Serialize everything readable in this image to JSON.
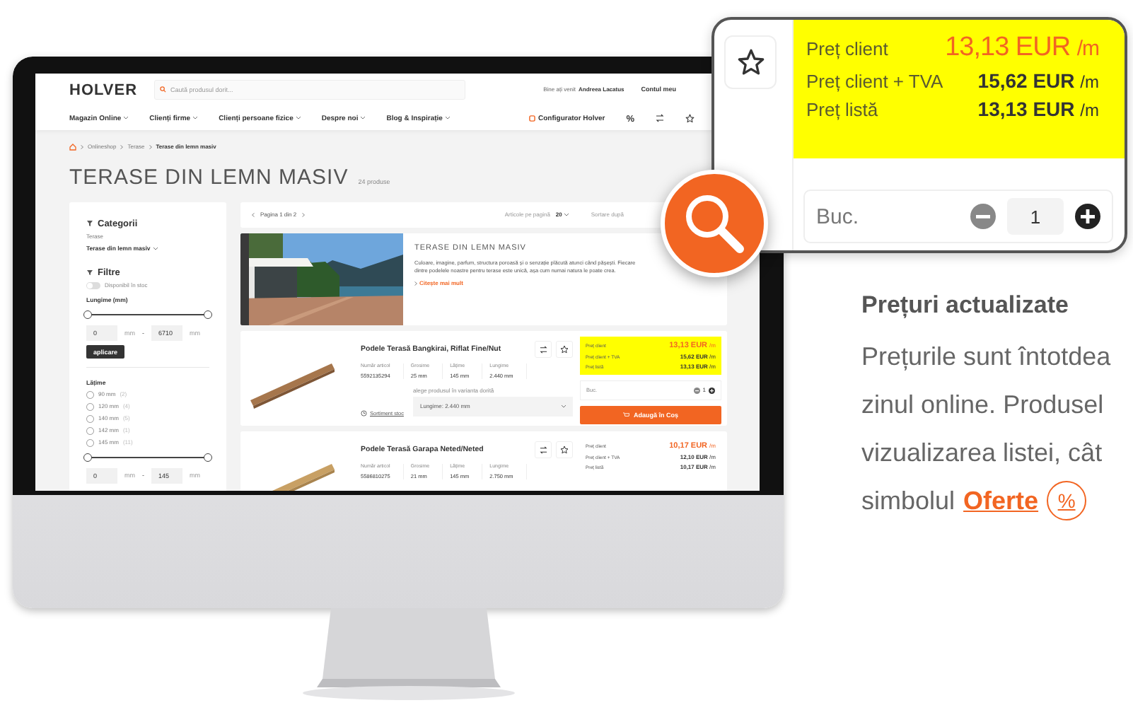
{
  "site": {
    "logo": "HOLVER",
    "search": {
      "placeholder": "Caută produsul dorit..."
    },
    "greeting": "Bine ați venit",
    "user": "Andreea Lacatus",
    "account": "Contul meu",
    "nav": [
      "Magazin Online",
      "Clienți firme",
      "Clienți persoane fizice",
      "Despre noi",
      "Blog & Inspirație"
    ],
    "configurator": "Configurator Holver",
    "offers_icon": "%",
    "breadcrumb": [
      "Onlineshop",
      "Terase",
      "Terase din lemn masiv"
    ],
    "title": "TERASE DIN LEMN MASIV",
    "count": "24 produse",
    "sidebar": {
      "heading": "Categorii",
      "category_label": "Terase",
      "category": "Terase din lemn masiv",
      "filters_heading": "Filtre",
      "stock_toggle": {
        "label": "Disponibil în stoc",
        "on": false
      },
      "filters": [
        {
          "label": "Lungime (mm)",
          "range": {
            "min": "0",
            "min_unit": "mm",
            "max": "6710",
            "max_unit": "mm",
            "separator": "-",
            "level": 1
          },
          "button": "aplicare"
        },
        {
          "label": "Lățime",
          "options": [
            {
              "label": "90 mm",
              "count": "(2)",
              "checked": false
            },
            {
              "label": "120 mm",
              "count": "(4)",
              "checked": false
            },
            {
              "label": "140 mm",
              "count": "(5)",
              "checked": false
            },
            {
              "label": "142 mm",
              "count": "(1)",
              "checked": false
            },
            {
              "label": "145 mm",
              "count": "(11)",
              "checked": false
            }
          ],
          "range": {
            "min": "0",
            "min_unit": "mm",
            "max": "145",
            "max_unit": "mm",
            "separator": "-",
            "level": 1
          }
        }
      ]
    },
    "toolbar": {
      "pagination": "Pagina 1 din 2",
      "per_page_label": "Articole pe pagină",
      "per_page": "20",
      "sort_label": "Sortare după"
    },
    "banner": {
      "title": "TERASE DIN LEMN MASIV",
      "text": "Culoare, imagine, parfum, structura poroasă și o senzație plăcută atunci când pășești. Fiecare dintre podelele noastre pentru terase este unică, așa cum numai natura le poate crea.",
      "more": "Citește mai mult"
    },
    "products": [
      {
        "name": "Podele Terasă Bangkirai, Riflat Fine/Nut",
        "specs": [
          {
            "label": "Număr articol",
            "value": "5592135294"
          },
          {
            "label": "Grosime",
            "value": "25 mm"
          },
          {
            "label": "Lățime",
            "value": "145 mm"
          },
          {
            "label": "Lungime",
            "value": "2.440 mm"
          }
        ],
        "stock": "Sortiment stoc",
        "variant_label": "alege produsul în varianta dorită",
        "variant": "Lungime: 2.440 mm",
        "prices": [
          {
            "label": "Preț client",
            "value": "13,13 EUR",
            "unit": "/m",
            "emphasis": true
          },
          {
            "label": "Preț client + TVA",
            "value": "15,62 EUR",
            "unit": "/m",
            "emphasis": false
          },
          {
            "label": "Preț listă",
            "value": "13,13 EUR",
            "unit": "/m",
            "emphasis": false
          }
        ],
        "highlighted": true,
        "qty_label": "Buc.",
        "qty": "1",
        "cart": "Adaugă în Coș"
      },
      {
        "name": "Podele Terasă Garapa Neted/Neted",
        "specs": [
          {
            "label": "Număr articol",
            "value": "5586810275"
          },
          {
            "label": "Grosime",
            "value": "21 mm"
          },
          {
            "label": "Lățime",
            "value": "145 mm"
          },
          {
            "label": "Lungime",
            "value": "2.750 mm"
          }
        ],
        "prices": [
          {
            "label": "Preț client",
            "value": "10,17 EUR",
            "unit": "/m",
            "emphasis": true
          },
          {
            "label": "Preț client + TVA",
            "value": "12,10 EUR",
            "unit": "/m",
            "emphasis": false
          },
          {
            "label": "Preț listă",
            "value": "10,17 EUR",
            "unit": "/m",
            "emphasis": false
          }
        ],
        "highlighted": false
      }
    ]
  },
  "callout": {
    "prices": [
      {
        "label": "Preț client",
        "value": "13,13 EUR",
        "unit": "/m",
        "emphasis": true
      },
      {
        "label": "Preț client + TVA",
        "value": "15,62 EUR",
        "unit": "/m",
        "emphasis": false
      },
      {
        "label": "Preț listă",
        "value": "13,13 EUR",
        "unit": "/m",
        "emphasis": false
      }
    ],
    "qty_label": "Buc.",
    "qty": "1"
  },
  "info": {
    "heading": "Prețuri actualizate",
    "lines": [
      "Prețurile sunt întotdea",
      "zinul online. Produsel",
      "vizualizarea listei, cât"
    ],
    "last_line": "simbolul",
    "link": "Oferte",
    "link_icon": "%"
  }
}
